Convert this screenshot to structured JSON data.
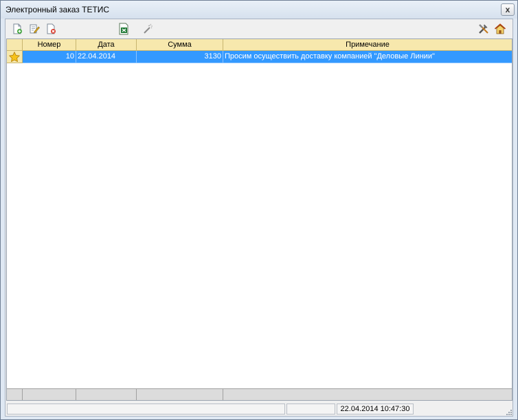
{
  "window": {
    "title": "Электронный заказ ТЕТИС",
    "close_glyph": "x"
  },
  "toolbar": {
    "left_icons": [
      "add-document-icon",
      "edit-document-icon",
      "delete-document-icon",
      "excel-export-icon",
      "magic-wand-icon"
    ],
    "right_icons": [
      "tools-icon",
      "home-icon"
    ]
  },
  "grid": {
    "columns": [
      "Номер",
      "Дата",
      "Сумма",
      "Примечание"
    ],
    "rows": [
      {
        "indicator_icon": "star-icon",
        "number": "10",
        "date": "22.04.2014",
        "sum": "3130",
        "note": "Просим осуществить доставку компанией \"Деловые Линии\""
      }
    ],
    "selected_color": "#3399ff",
    "header_color": "#f7e8ad"
  },
  "status": {
    "panel1": "",
    "panel2": "",
    "datetime": "22.04.2014 10:47:30"
  }
}
